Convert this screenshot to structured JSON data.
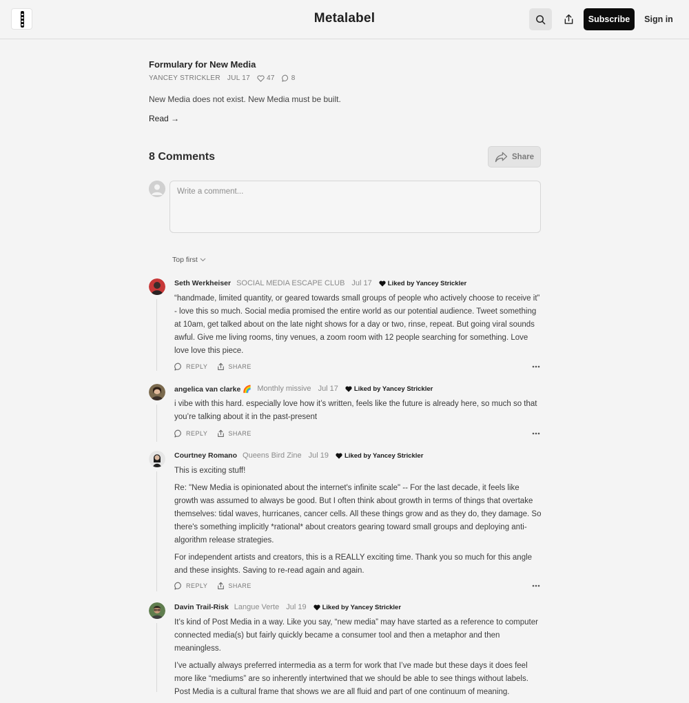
{
  "header": {
    "site_title": "Metalabel",
    "subscribe_label": "Subscribe",
    "signin_label": "Sign in"
  },
  "post": {
    "title": "Formulary for New Media",
    "author": "YANCEY STRICKLER",
    "date": "JUL 17",
    "likes": "47",
    "comments": "8",
    "subtitle": "New Media does not exist. New Media must be built.",
    "read_label": "Read →"
  },
  "comments_section": {
    "heading": "8 Comments",
    "share_label": "Share",
    "placeholder": "Write a comment...",
    "sort_label": "Top first"
  },
  "actions": {
    "reply": "REPLY",
    "share": "SHARE"
  },
  "comments": [
    {
      "name": "Seth Werkheiser",
      "publication": "SOCIAL MEDIA ESCAPE CLUB",
      "date": "Jul 17",
      "liked_by": "Liked by Yancey Strickler",
      "paragraphs": [
        "“handmade, limited quantity, or geared towards small groups of people who actively choose to receive it” - love this so much. Social media promised the entire world as our potential audience. Tweet something at 10am, get talked about on the late night shows for a day or two, rinse, repeat. But going viral sounds awful. Give me living rooms, tiny venues, a zoom room with 12 people searching for something. Love love love this piece."
      ]
    },
    {
      "name": "angelica van clarke 🌈",
      "publication": "Monthly missive",
      "date": "Jul 17",
      "liked_by": "Liked by Yancey Strickler",
      "paragraphs": [
        "i vibe with this hard. especially love how it’s written, feels like the future is already here, so much so that you’re talking about it in the past-present"
      ]
    },
    {
      "name": "Courtney Romano",
      "publication": "Queens Bird Zine",
      "date": "Jul 19",
      "liked_by": "Liked by Yancey Strickler",
      "paragraphs": [
        "This is exciting stuff!",
        "Re: \"New Media is opinionated about the internet's infinite scale\" -- For the last decade, it feels like growth was assumed to always be good. But I often think about growth in terms of things that overtake themselves: tidal waves, hurricanes, cancer cells. All these things grow and as they do, they damage. So there's something implicitly *rational* about creators gearing toward small groups and deploying anti-algorithm release strategies.",
        "For independent artists and creators, this is a REALLY exciting time. Thank you so much for this angle and these insights. Saving to re-read again and again."
      ]
    },
    {
      "name": "Davin Trail-Risk",
      "publication": "Langue Verte",
      "date": "Jul 19",
      "liked_by": "Liked by Yancey Strickler",
      "paragraphs": [
        "It’s kind of Post Media in a way. Like you say, “new media” may have started as a reference to computer connected media(s) but fairly quickly became a consumer tool and then a metaphor and then meaningless.",
        "I’ve actually always preferred intermedia as a term for work that I’ve made but these days it does feel more like “mediums” are so inherently intertwined that we should be able to see things without labels. Post Media is a cultural frame that shows we are all fluid and part of one continuum of meaning."
      ]
    }
  ]
}
